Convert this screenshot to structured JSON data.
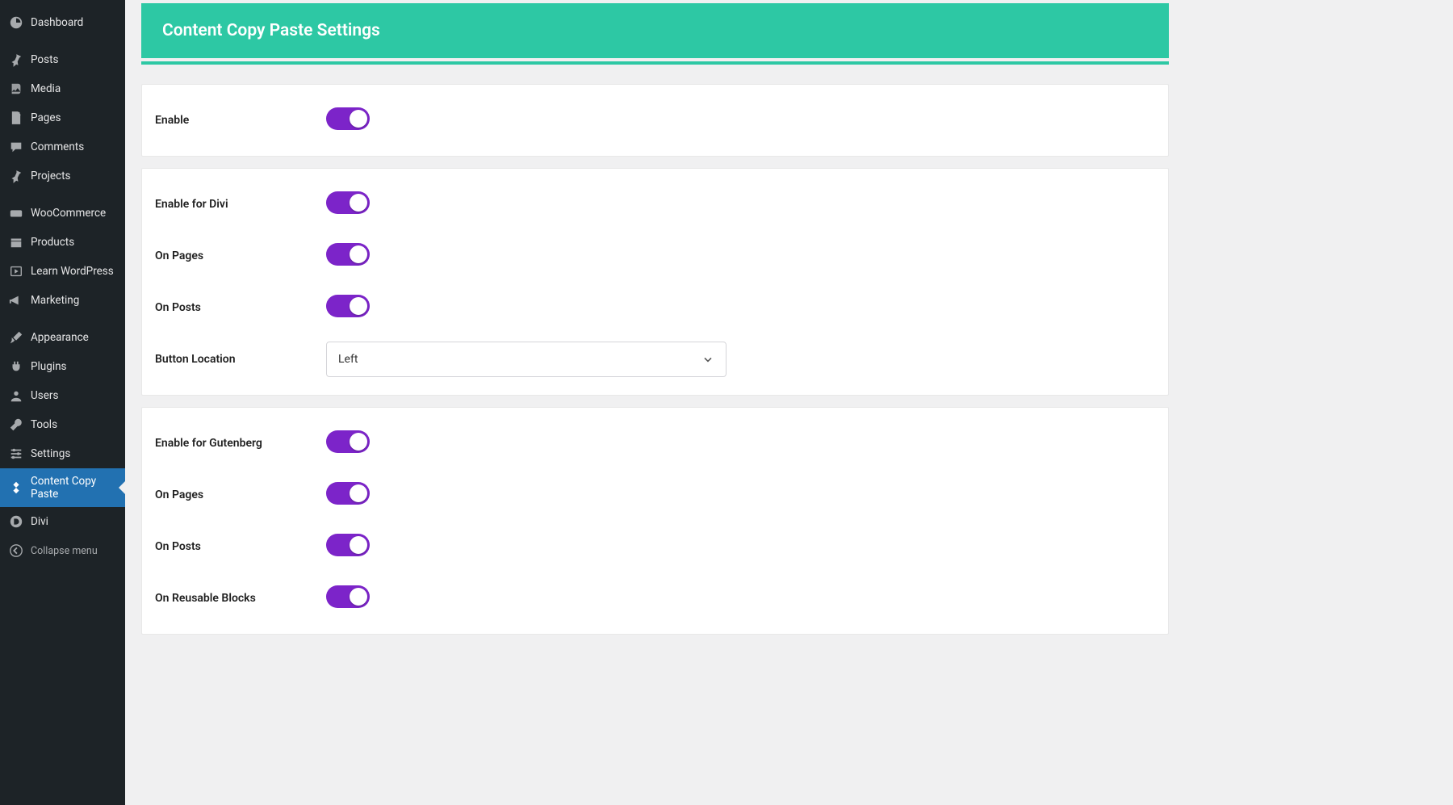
{
  "sidebar": {
    "items": [
      {
        "label": "Dashboard",
        "icon": "dashboard"
      },
      {
        "label": "Posts",
        "icon": "pin"
      },
      {
        "label": "Media",
        "icon": "media"
      },
      {
        "label": "Pages",
        "icon": "pages"
      },
      {
        "label": "Comments",
        "icon": "comment"
      },
      {
        "label": "Projects",
        "icon": "pin"
      },
      {
        "label": "WooCommerce",
        "icon": "woo"
      },
      {
        "label": "Products",
        "icon": "products"
      },
      {
        "label": "Learn WordPress",
        "icon": "learn"
      },
      {
        "label": "Marketing",
        "icon": "megaphone"
      },
      {
        "label": "Appearance",
        "icon": "brush"
      },
      {
        "label": "Plugins",
        "icon": "plugin"
      },
      {
        "label": "Users",
        "icon": "user"
      },
      {
        "label": "Tools",
        "icon": "wrench"
      },
      {
        "label": "Settings",
        "icon": "sliders"
      },
      {
        "label": "Content Copy Paste",
        "icon": "diamond",
        "active": true
      },
      {
        "label": "Divi",
        "icon": "divi"
      },
      {
        "label": "Collapse menu",
        "icon": "collapse",
        "collapse": true
      }
    ]
  },
  "header": {
    "title": "Content Copy Paste Settings"
  },
  "panels": {
    "general": {
      "enable": "Enable"
    },
    "divi": {
      "enable": "Enable for Divi",
      "on_pages": "On Pages",
      "on_posts": "On Posts",
      "button_location_label": "Button Location",
      "button_location_value": "Left"
    },
    "gutenberg": {
      "enable": "Enable for Gutenberg",
      "on_pages": "On Pages",
      "on_posts": "On Posts",
      "on_reusable": "On Reusable Blocks"
    }
  }
}
